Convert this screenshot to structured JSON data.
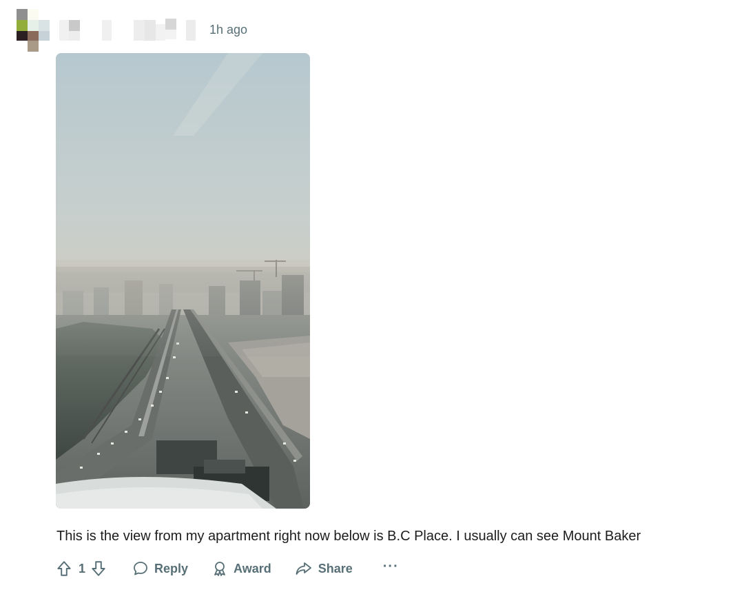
{
  "comment": {
    "author_avatar_alt": "user-avatar",
    "timestamp": "1h ago",
    "text": "This is the view from my apartment right now below is B.C Place. I usually can see Mount Baker",
    "media": {
      "kind": "photo",
      "subject": "smoky city skyline"
    }
  },
  "actions": {
    "vote_count": "1",
    "reply_label": "Reply",
    "award_label": "Award",
    "share_label": "Share",
    "more_label": "···"
  },
  "colors": {
    "meta_text": "#576f76",
    "body_text": "#1c1c1c"
  },
  "icons": {
    "upvote": "arrow-up-icon",
    "downvote": "arrow-down-icon",
    "reply": "speech-bubble-icon",
    "award": "award-ribbon-icon",
    "share": "share-arrow-icon",
    "more": "ellipsis-icon"
  }
}
